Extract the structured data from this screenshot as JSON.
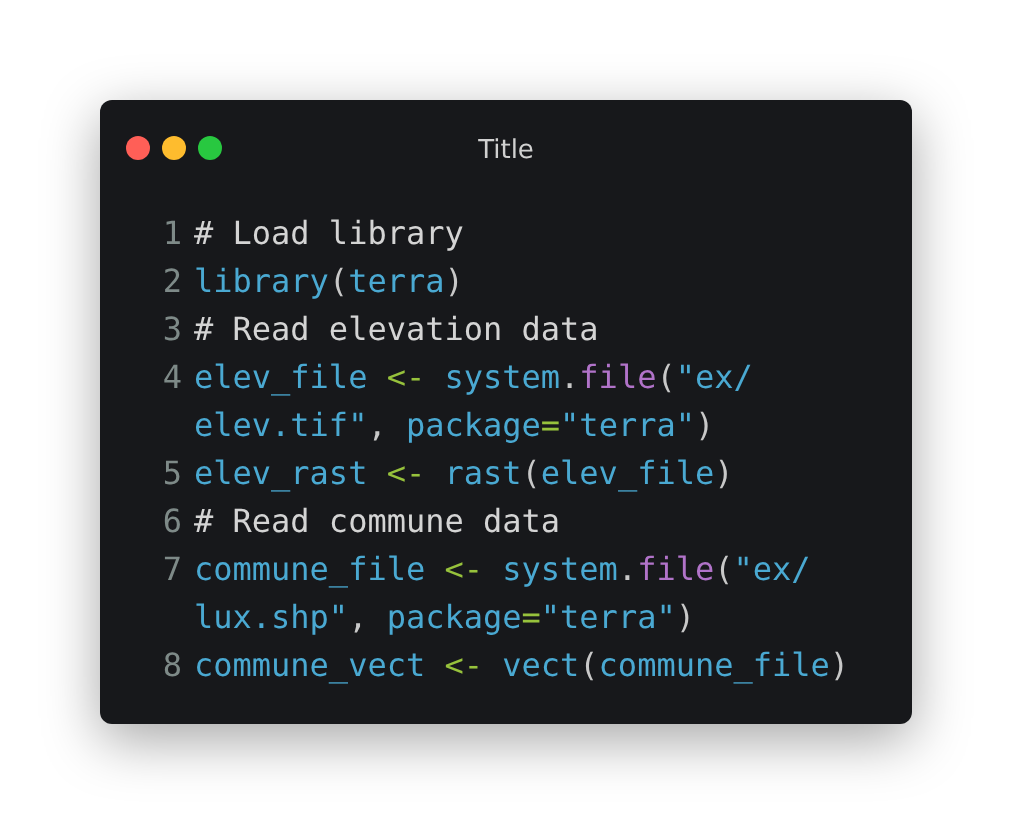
{
  "window": {
    "title": "Title"
  },
  "code": [
    {
      "number": "1",
      "rows": [
        {
          "tokens": [
            {
              "kind": "comment",
              "t": "# Load library"
            }
          ]
        }
      ]
    },
    {
      "number": "2",
      "rows": [
        {
          "tokens": [
            {
              "kind": "id",
              "t": "library"
            },
            {
              "kind": "punct",
              "t": "("
            },
            {
              "kind": "id",
              "t": "terra"
            },
            {
              "kind": "punct",
              "t": ")"
            }
          ]
        }
      ]
    },
    {
      "number": "3",
      "rows": [
        {
          "tokens": [
            {
              "kind": "comment",
              "t": "# Read elevation data"
            }
          ]
        }
      ]
    },
    {
      "number": "4",
      "rows": [
        {
          "tokens": [
            {
              "kind": "id",
              "t": "elev_file"
            },
            {
              "kind": "op",
              "t": " <- "
            },
            {
              "kind": "id",
              "t": "system"
            },
            {
              "kind": "punct",
              "t": "."
            },
            {
              "kind": "fn",
              "t": "file"
            },
            {
              "kind": "punct",
              "t": "("
            },
            {
              "kind": "id",
              "t": "\"ex/"
            }
          ]
        },
        {
          "tokens": [
            {
              "kind": "id",
              "t": "elev.tif\""
            },
            {
              "kind": "punct",
              "t": ", "
            },
            {
              "kind": "id",
              "t": "package"
            },
            {
              "kind": "op",
              "t": "="
            },
            {
              "kind": "id",
              "t": "\"terra\""
            },
            {
              "kind": "punct",
              "t": ")"
            }
          ]
        }
      ]
    },
    {
      "number": "5",
      "rows": [
        {
          "tokens": [
            {
              "kind": "id",
              "t": "elev_rast"
            },
            {
              "kind": "op",
              "t": " <- "
            },
            {
              "kind": "id",
              "t": "rast"
            },
            {
              "kind": "punct",
              "t": "("
            },
            {
              "kind": "id",
              "t": "elev_file"
            },
            {
              "kind": "punct",
              "t": ")"
            }
          ]
        }
      ]
    },
    {
      "number": "6",
      "rows": [
        {
          "tokens": [
            {
              "kind": "comment",
              "t": "# Read commune data"
            }
          ]
        }
      ]
    },
    {
      "number": "7",
      "rows": [
        {
          "tokens": [
            {
              "kind": "id",
              "t": "commune_file"
            },
            {
              "kind": "op",
              "t": " <- "
            },
            {
              "kind": "id",
              "t": "system"
            },
            {
              "kind": "punct",
              "t": "."
            },
            {
              "kind": "fn",
              "t": "file"
            },
            {
              "kind": "punct",
              "t": "("
            },
            {
              "kind": "id",
              "t": "\"ex/"
            }
          ]
        },
        {
          "tokens": [
            {
              "kind": "id",
              "t": "lux.shp\""
            },
            {
              "kind": "punct",
              "t": ", "
            },
            {
              "kind": "id",
              "t": "package"
            },
            {
              "kind": "op",
              "t": "="
            },
            {
              "kind": "id",
              "t": "\"terra\""
            },
            {
              "kind": "punct",
              "t": ")"
            }
          ]
        }
      ]
    },
    {
      "number": "8",
      "rows": [
        {
          "tokens": [
            {
              "kind": "id",
              "t": "commune_vect"
            },
            {
              "kind": "op",
              "t": " <- "
            },
            {
              "kind": "id",
              "t": "vect"
            },
            {
              "kind": "punct",
              "t": "("
            },
            {
              "kind": "id",
              "t": "commune_file"
            },
            {
              "kind": "punct",
              "t": ")"
            }
          ]
        }
      ]
    }
  ]
}
